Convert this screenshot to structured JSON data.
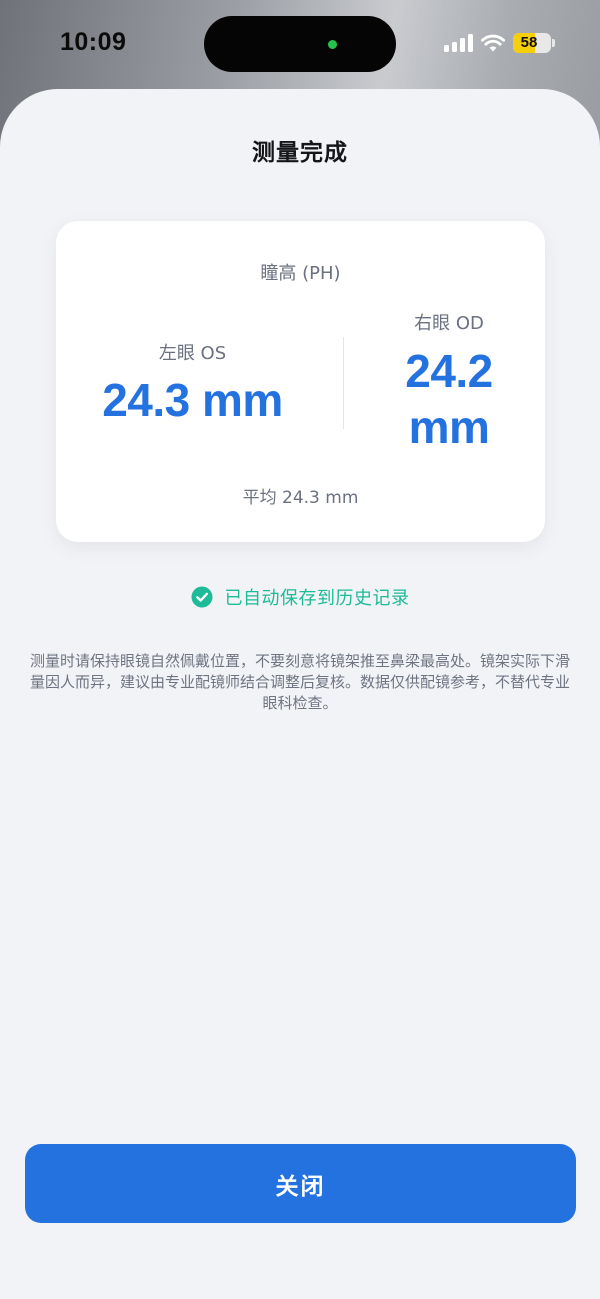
{
  "status_bar": {
    "time": "10:09",
    "battery_level": "58",
    "battery_fraction": 0.58,
    "battery_color": "#f6cf0c",
    "island_indicator_color": "#27c24c",
    "icons": [
      "signal-bars-icon",
      "wifi-icon",
      "battery-icon"
    ]
  },
  "sheet": {
    "title": "测量完成",
    "card": {
      "metric_label": "瞳高 (PH)",
      "left_eye_label": "左眼 OS",
      "left_eye_value": "24.3 mm",
      "right_eye_label": "右眼 OD",
      "right_eye_value": "24.2 mm",
      "average": "平均 24.3 mm"
    },
    "saved_status": {
      "icon": "check-circle-icon",
      "text": "已自动保存到历史记录",
      "color": "#1dbb97"
    },
    "disclaimer": "测量时请保持眼镜自然佩戴位置，不要刻意将镜架推至鼻梁最高处。镜架实际下滑量因人而异，建议由专业配镜师结合调整后复核。数据仅供配镜参考，不替代专业眼科检查。",
    "close_button_label": "关闭",
    "accent_color": "#2472df"
  }
}
